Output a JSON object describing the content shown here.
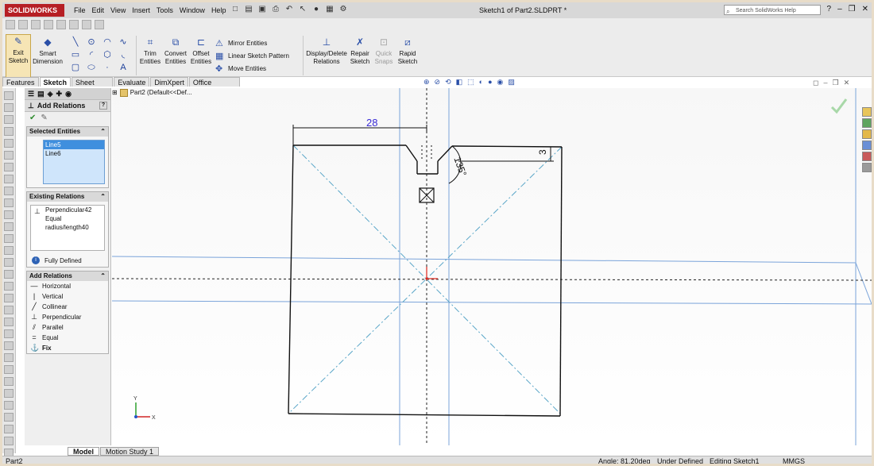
{
  "app": {
    "logo": "SOLIDWORKS",
    "doc_title": "Sketch1 of Part2.SLDPRT *",
    "search_placeholder": "Search SolidWorks Help"
  },
  "menu": [
    "File",
    "Edit",
    "View",
    "Insert",
    "Tools",
    "Window",
    "Help"
  ],
  "commands": {
    "exit_sketch": "Exit\nSketch",
    "smart_dimension": "Smart\nDimension",
    "trim": "Trim\nEntities",
    "convert": "Convert\nEntities",
    "offset": "Offset\nEntities",
    "mirror": "Mirror Entities",
    "linear_pattern": "Linear Sketch Pattern",
    "move": "Move Entities",
    "display_delete": "Display/Delete\nRelations",
    "repair": "Repair\nSketch",
    "quick_snaps": "Quick\nSnaps",
    "rapid_sketch": "Rapid\nSketch"
  },
  "tabs": [
    "Features",
    "Sketch",
    "Sheet Metal",
    "Evaluate",
    "DimXpert",
    "Office Products"
  ],
  "active_tab": "Sketch",
  "property_manager": {
    "title": "Add Relations",
    "selected_entities": {
      "title": "Selected Entities",
      "items": [
        "Line5",
        "Line6"
      ]
    },
    "existing_relations": {
      "title": "Existing Relations",
      "items": [
        "Perpendicular42",
        "Equal radius/length40"
      ],
      "status": "Fully Defined"
    },
    "add_relations": {
      "title": "Add Relations",
      "items": [
        "Horizontal",
        "Vertical",
        "Collinear",
        "Perpendicular",
        "Parallel",
        "Equal",
        "Fix"
      ]
    }
  },
  "feature_tree": {
    "label": "Part2  (Default<<Def..."
  },
  "drawing": {
    "dim_horizontal": "28",
    "dim_vertical": "3",
    "dim_angle": "135°",
    "axis_y": "Y",
    "axis_x": "X"
  },
  "bottom_tabs": [
    "Model",
    "Motion Study 1"
  ],
  "status": {
    "part": "Part2",
    "angle": "Angle: 81.20deg",
    "defined": "Under Defined",
    "editing": "Editing Sketch1",
    "units": "MMGS"
  }
}
